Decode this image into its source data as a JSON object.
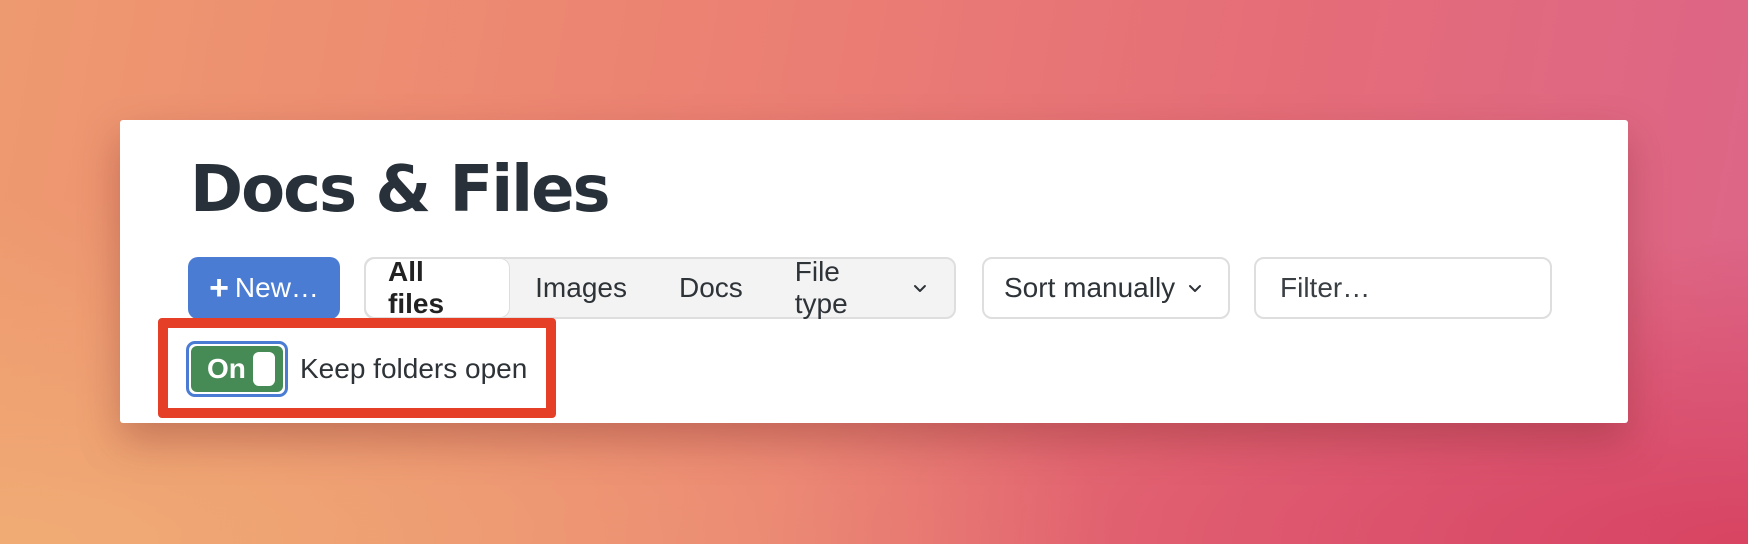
{
  "page": {
    "title": "Docs & Files"
  },
  "toolbar": {
    "new_button": {
      "icon": "plus-icon",
      "label": "New…"
    },
    "tabs": [
      {
        "label": "All files",
        "active": true
      },
      {
        "label": "Images",
        "active": false
      },
      {
        "label": "Docs",
        "active": false
      },
      {
        "label": "File type",
        "dropdown": true,
        "icon": "chevron-down-icon"
      }
    ],
    "sort": {
      "label": "Sort manually",
      "icon": "chevron-down-icon"
    },
    "filter": {
      "placeholder": "Filter…"
    }
  },
  "option": {
    "toggle_state": "On",
    "label": "Keep folders open"
  },
  "colors": {
    "accent": "#4a7cd4",
    "toggle_on": "#468a55",
    "highlight": "#e63f28",
    "title": "#283139"
  }
}
